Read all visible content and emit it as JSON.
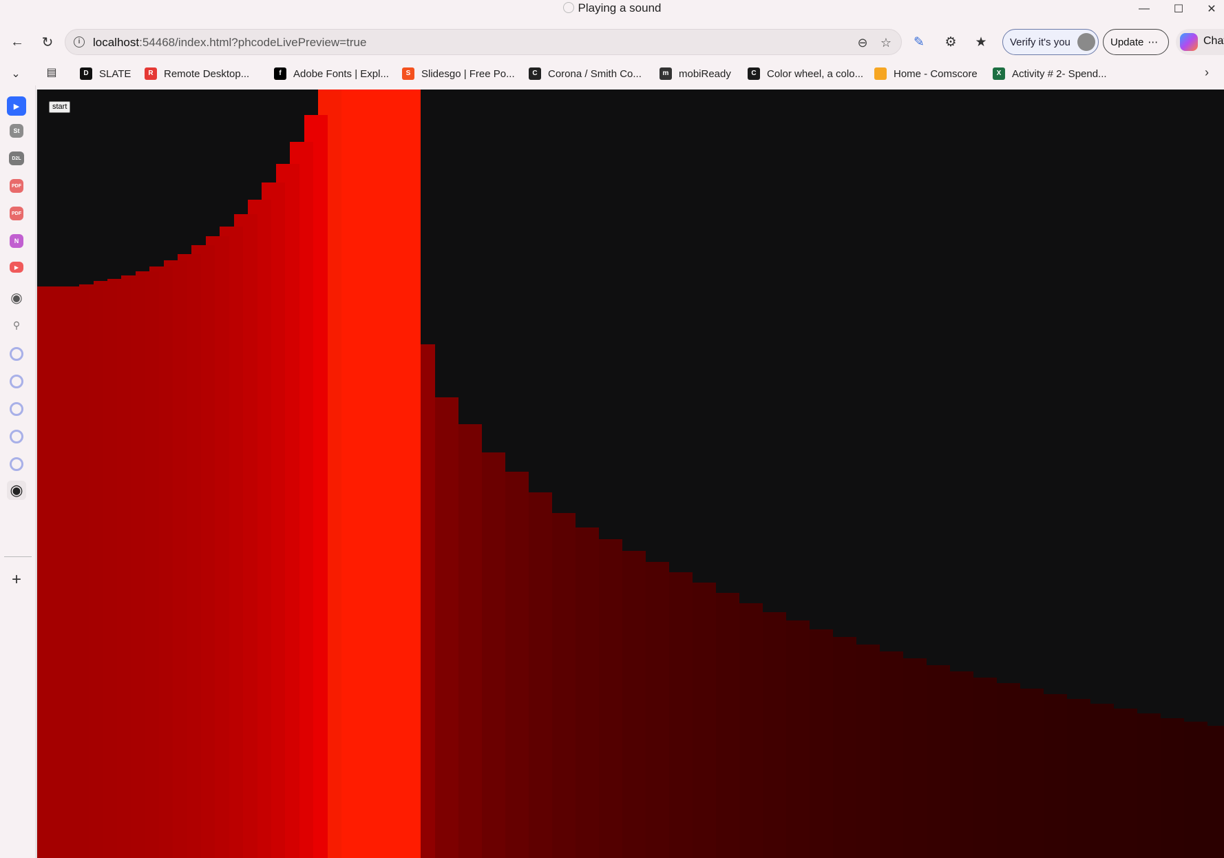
{
  "window": {
    "title": "Playing a sound"
  },
  "address_bar": {
    "url_host": "localhost",
    "url_rest": ":54468/index.html?phcodeLivePreview=true"
  },
  "toolbar": {
    "verify_label": "Verify it's you",
    "update_label": "Update",
    "chat_label": "Chat"
  },
  "bookmarks": [
    {
      "label": "SLATE",
      "icon": "d2l-icon",
      "color": "#111111"
    },
    {
      "label": "Remote Desktop...",
      "icon": "remote-desktop-icon",
      "color": "#e53935"
    },
    {
      "label": "Adobe Fonts | Expl...",
      "icon": "adobe-fonts-icon",
      "color": "#000000"
    },
    {
      "label": "Slidesgo | Free Po...",
      "icon": "slidesgo-icon",
      "color": "#f4511e"
    },
    {
      "label": "Corona / Smith Co...",
      "icon": "corona-icon",
      "color": "#222222"
    },
    {
      "label": "mobiReady",
      "icon": "mobiready-icon",
      "color": "#333333"
    },
    {
      "label": "Color wheel, a colo...",
      "icon": "color-wheel-icon",
      "color": "#1a1a1a"
    },
    {
      "label": "Home - Comscore",
      "icon": "folder-icon",
      "color": "#f6a623"
    },
    {
      "label": "Activity # 2- Spend...",
      "icon": "excel-icon",
      "color": "#1d6f42"
    }
  ],
  "page": {
    "start_label": "start"
  },
  "visualizer": {
    "bars": [
      0.722,
      0.722,
      0.722,
      0.725,
      0.729,
      0.732,
      0.736,
      0.741,
      0.747,
      0.755,
      0.763,
      0.774,
      0.786,
      0.798,
      0.813,
      0.832,
      0.853,
      0.877,
      0.905,
      0.939,
      0.977,
      1.0,
      1.0,
      0.873,
      0.649,
      0.582,
      0.548,
      0.512,
      0.488,
      0.462,
      0.436,
      0.418,
      0.403,
      0.388,
      0.374,
      0.361,
      0.348,
      0.335,
      0.322,
      0.311,
      0.3,
      0.289,
      0.279,
      0.27,
      0.261,
      0.252,
      0.244,
      0.236,
      0.228,
      0.221,
      0.214,
      0.207,
      0.201,
      0.195,
      0.189,
      0.183,
      0.177,
      0.172,
      0.167,
      0.162
    ]
  }
}
